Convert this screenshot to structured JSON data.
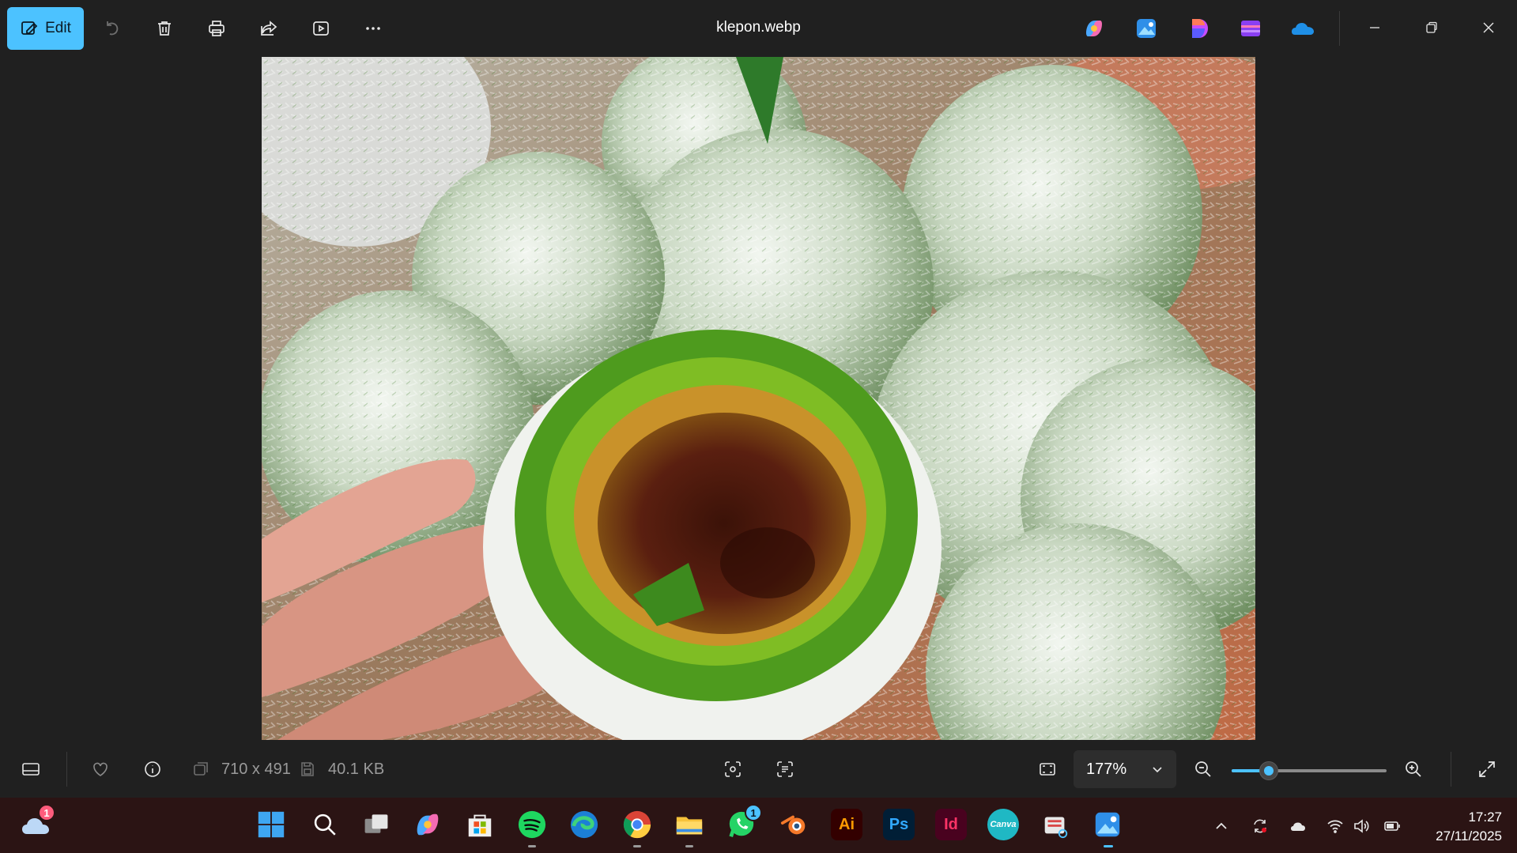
{
  "toolbar": {
    "edit_label": "Edit",
    "file_name": "klepon.webp",
    "icons": [
      "edit-image-icon",
      "rotate-icon",
      "delete-icon",
      "print-icon",
      "share-icon",
      "slideshow-icon",
      "more-icon"
    ],
    "apps": [
      "copilot-icon",
      "photos-app-icon",
      "designer-icon",
      "clipchamp-icon",
      "onedrive-icon"
    ],
    "window": [
      "minimize-icon",
      "restore-icon",
      "close-icon"
    ]
  },
  "info": {
    "dimensions": "710 x 491",
    "file_size": "40.1 KB",
    "zoom": "177%",
    "zoom_fraction": 0.24
  },
  "taskbar": {
    "weather_badge": "1",
    "whatsapp_badge": "1",
    "illustrator_label": "Ai",
    "photoshop_label": "Ps",
    "indesign_label": "Id",
    "canva_label": "Canva",
    "time": "17:27",
    "date": "27/11/2025"
  },
  "colors": {
    "accent": "#4cc2ff",
    "background": "#202020",
    "taskbar": "#2b1414"
  }
}
